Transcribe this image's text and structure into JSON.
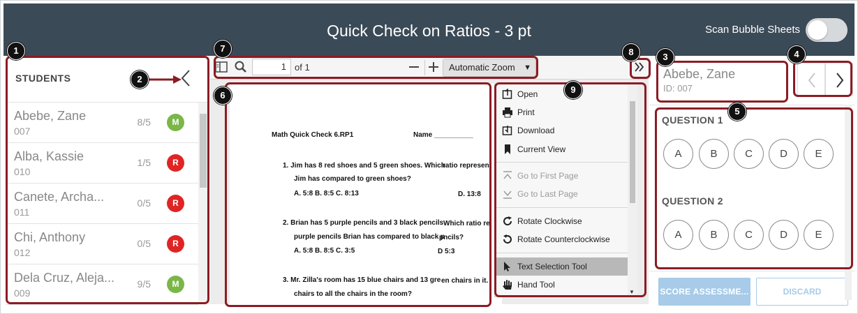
{
  "header": {
    "title": "Quick Check on Ratios - 3 pt",
    "scan_label": "Scan Bubble Sheets",
    "scan_enabled": false
  },
  "students": {
    "heading": "STUDENTS",
    "items": [
      {
        "name": "Abebe, Zane",
        "id": "007",
        "score": "8/5",
        "badge": "M",
        "badge_color": "#7ab648"
      },
      {
        "name": "Alba, Kassie",
        "id": "010",
        "score": "1/5",
        "badge": "R",
        "badge_color": "#e02424"
      },
      {
        "name": "Canete, Archa...",
        "id": "011",
        "score": "0/5",
        "badge": "R",
        "badge_color": "#e02424"
      },
      {
        "name": "Chi, Anthony",
        "id": "012",
        "score": "0/5",
        "badge": "R",
        "badge_color": "#e02424"
      },
      {
        "name": "Dela Cruz, Aleja...",
        "id": "009",
        "score": "9/5",
        "badge": "M",
        "badge_color": "#7ab648"
      }
    ]
  },
  "pdf_toolbar": {
    "page_value": "1",
    "page_of": "of 1",
    "zoom": "Automatic Zoom"
  },
  "document": {
    "heading": "Math Quick Check 6.RP1",
    "name_field": "Name __________",
    "lines": [
      "1.   Jim has 8 red shoes and 5 green shoes. Which",
      "ratio represen",
      "Jim has compared to green shoes?",
      "A.  5:8        B.  8:5         C.  8:13",
      "D.  13:8",
      "2.   Brian has 5 purple pencils and 3 black pencils",
      "Which ratio re",
      "purple pencils Brian has compared to black p",
      "pncils?",
      "A.  5:8        B.  8:5         C.  3:5",
      "D 5:3",
      "3.   Mr. Zilla's room has 15 blue chairs and 13 gre",
      "en chairs in it.",
      "chairs to all the chairs in the room?"
    ]
  },
  "menu": {
    "items": [
      {
        "label": "Open",
        "icon": "open-file-icon",
        "disabled": false
      },
      {
        "label": "Print",
        "icon": "printer-icon",
        "disabled": false
      },
      {
        "label": "Download",
        "icon": "download-icon",
        "disabled": false
      },
      {
        "label": "Current View",
        "icon": "bookmark-icon",
        "disabled": false
      },
      {
        "label": "Go to First Page",
        "icon": "first-page-icon",
        "disabled": true
      },
      {
        "label": "Go to Last Page",
        "icon": "last-page-icon",
        "disabled": true
      },
      {
        "label": "Rotate Clockwise",
        "icon": "rotate-cw-icon",
        "disabled": false
      },
      {
        "label": "Rotate Counterclockwise",
        "icon": "rotate-ccw-icon",
        "disabled": false
      },
      {
        "label": "Text Selection Tool",
        "icon": "cursor-icon",
        "disabled": false,
        "active": true
      },
      {
        "label": "Hand Tool",
        "icon": "hand-icon",
        "disabled": false
      }
    ]
  },
  "selected_student": {
    "name": "Abebe, Zane",
    "id_label": "ID: 007"
  },
  "questions": [
    {
      "title": "QUESTION 1",
      "options": [
        "A",
        "B",
        "C",
        "D",
        "E"
      ]
    },
    {
      "title": "QUESTION 2",
      "options": [
        "A",
        "B",
        "C",
        "D",
        "E"
      ]
    }
  ],
  "actions": {
    "score": "SCORE ASSESSME...",
    "discard": "DISCARD"
  },
  "callouts": [
    "1",
    "2",
    "3",
    "4",
    "5",
    "6",
    "7",
    "8",
    "9"
  ],
  "colors": {
    "header_bg": "#3b4a57",
    "callout_border": "#8b1c24",
    "mastery_green": "#7ab648",
    "remediation_red": "#e02424",
    "score_button": "#a7cbe8"
  }
}
